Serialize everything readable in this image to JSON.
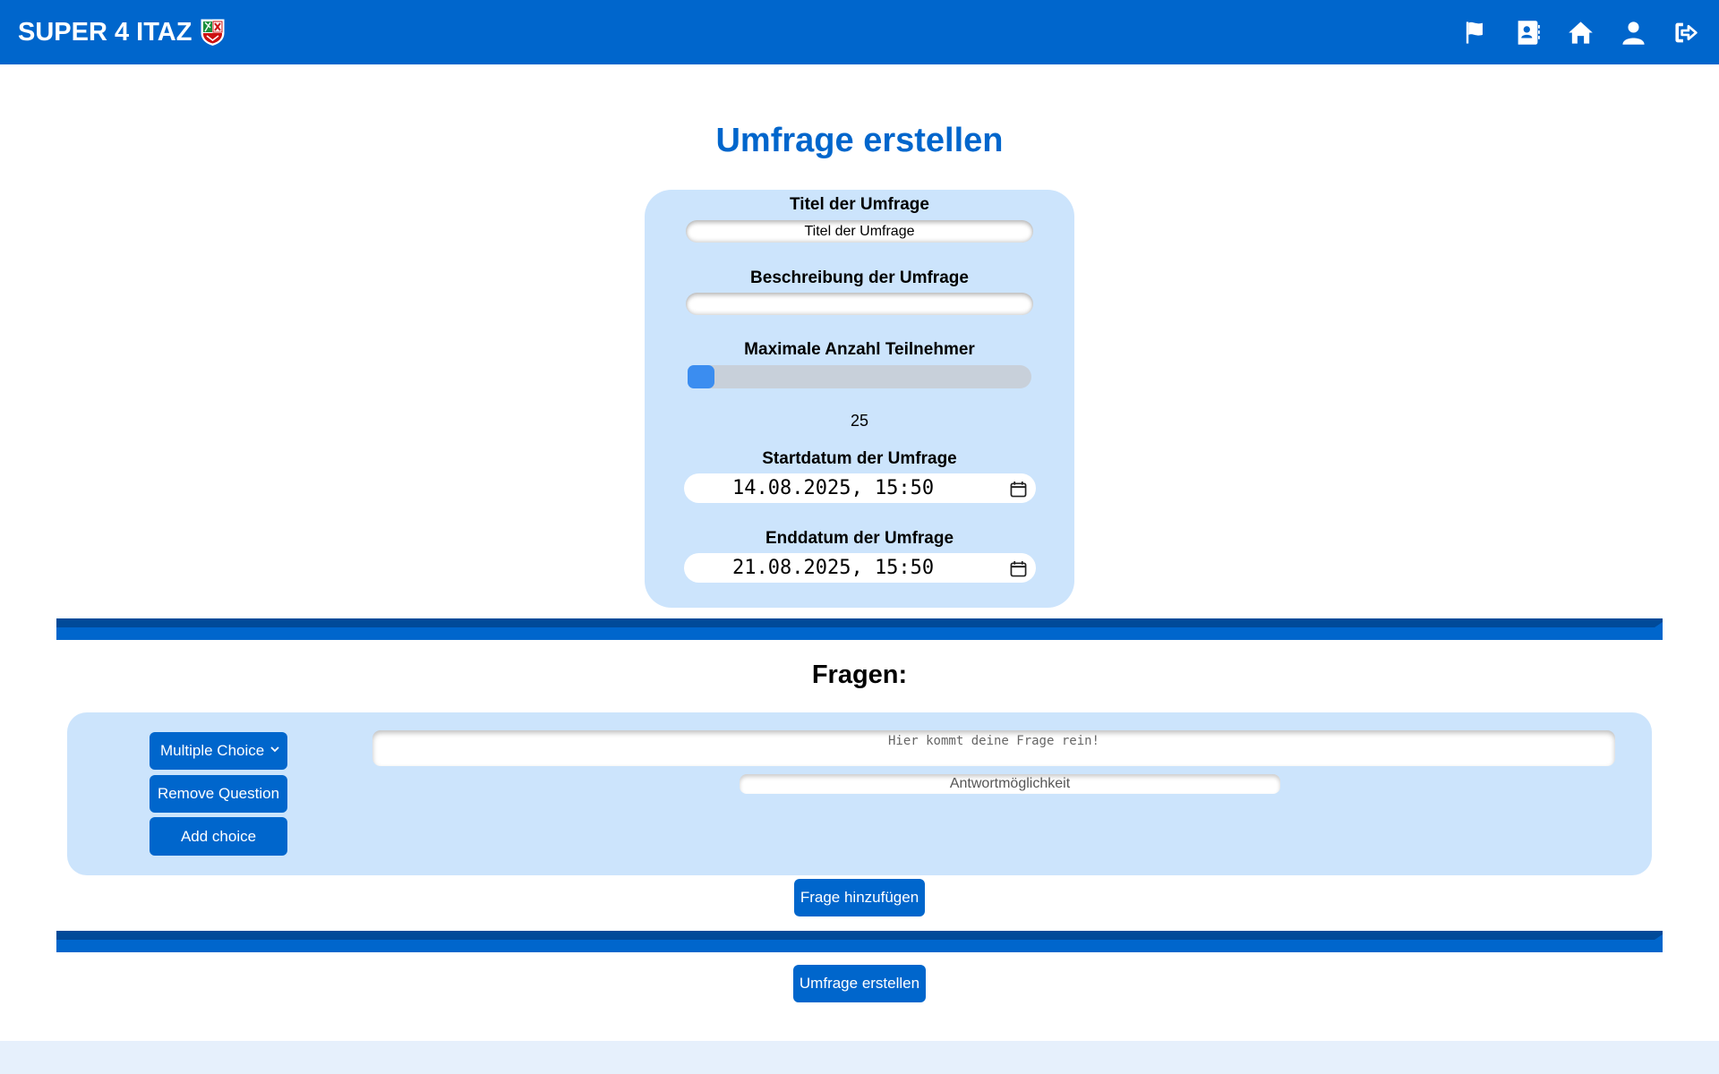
{
  "header": {
    "brand": "SUPER 4 ITAZ",
    "icons": [
      "flag-icon",
      "contact-book-icon",
      "home-icon",
      "user-icon",
      "logout-icon"
    ],
    "accent_color": "#0066cc"
  },
  "page_title": "Umfrage erstellen",
  "form": {
    "title_label": "Titel der Umfrage",
    "title_value": "Titel der Umfrage",
    "description_label": "Beschreibung der Umfrage",
    "description_value": "",
    "max_participants_label": "Maximale Anzahl Teilnehmer",
    "max_participants_value": "25",
    "start_label": "Startdatum der Umfrage",
    "start_value": "14.08.2025, 15:50",
    "end_label": "Enddatum der Umfrage",
    "end_value": "21.08.2025, 15:50"
  },
  "questions": {
    "section_title": "Fragen:",
    "type_select": "Multiple Choice",
    "remove_label": "Remove Question",
    "add_choice_label": "Add choice",
    "question_placeholder": "Hier kommt deine Frage rein!",
    "choice_placeholder": "Antwortmöglichkeit",
    "add_question_label": "Frage hinzufügen"
  },
  "submit_label": "Umfrage erstellen"
}
